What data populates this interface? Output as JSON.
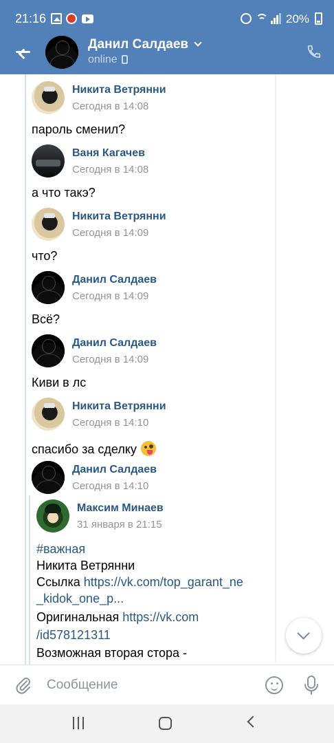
{
  "status_bar": {
    "time": "21:16",
    "battery": "20%"
  },
  "header": {
    "name": "Данил Салдаев",
    "status": "online"
  },
  "messages": [
    {
      "author": "Никита Ветрянни",
      "date": "Сегодня в 14:08",
      "text": "пароль сменил?"
    },
    {
      "author": "Ваня Кагачев",
      "date": "Сегодня в 14:08",
      "text": "а что такэ?"
    },
    {
      "author": "Никита Ветрянни",
      "date": "Сегодня в 14:09",
      "text": "что?"
    },
    {
      "author": "Данил Салдаев",
      "date": "Сегодня в 14:09",
      "text": "Всё?"
    },
    {
      "author": "Данил Салдаев",
      "date": "Сегодня в 14:09",
      "text": "Киви в лс"
    },
    {
      "author": "Никита Ветрянни",
      "date": "Сегодня в 14:10",
      "text": "спасибо за сделку"
    },
    {
      "author": "Данил Салдаев",
      "date": "Сегодня в 14:10",
      "text": ""
    }
  ],
  "forwarded": {
    "author": "Максим Минаев",
    "date": "31 января в 21:15",
    "hashtag": "#важная",
    "line1": "Никита Ветрянни",
    "line2_label": "Ссылка ",
    "line2_link_a": "https://vk.com/top_garant_ne",
    "line2_link_b": "_kidok_one_p...",
    "line3_label": "Оригинальная ",
    "line3_link_a": "https://vk.com",
    "line3_link_b": "/id578121311",
    "line4": "Возможная вторая стора -"
  },
  "input": {
    "placeholder": "Сообщение"
  },
  "icons": {
    "back": "arrow-left-icon",
    "call": "phone-icon",
    "attach": "paperclip-icon",
    "emoji": "smile-icon",
    "mic": "microphone-icon",
    "scroll": "chevron-down-icon"
  },
  "colors": {
    "header_bg": "#5181b8",
    "link": "#2a5885",
    "meta": "#939393"
  }
}
